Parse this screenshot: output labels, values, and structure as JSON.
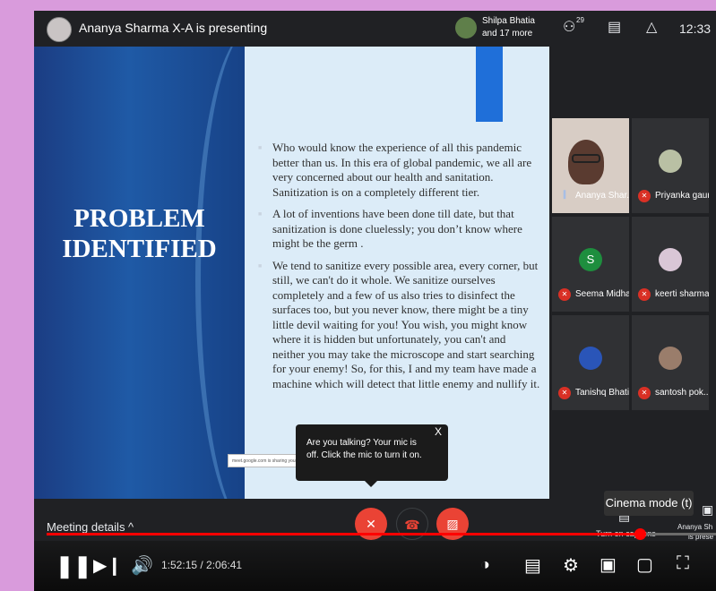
{
  "top_bar": {
    "presenter_text": "Ananya Sharma X-A is presenting",
    "participants_line1": "Shilpa Bhatia",
    "participants_line2": "and 17 more",
    "people_count": "29",
    "clock": "12:33",
    "icons": [
      "people-icon",
      "chat-icon",
      "activities-icon"
    ]
  },
  "slide": {
    "title_line1": "PROBLEM",
    "title_line2": "IDENTIFIED",
    "paragraphs": [
      "Who would know the experience of all this pandemic better than us. In this era of global pandemic, we all are very concerned about our health and sanitation. Sanitization is on a completely different tier.",
      "A lot of inventions have been done till date, but that sanitization is done cluelessly; you don’t know where might be the germ .",
      "We tend to sanitize every possible area, every corner, but still, we can't do it whole. We sanitize ourselves completely and a few of us also tries to disinfect the surfaces too, but you never know, there might be a tiny little devil waiting for you! You wish, you might know where it is hidden but unfortunately, you can't and neither you may take the microscope and start searching for your enemy! So, for this, I and my team have made a machine which will detect that little enemy and nullify it."
    ],
    "share_chip": "meet.google.com is sharing your screen"
  },
  "mic_tooltip": {
    "text": "Are you talking? Your mic is off. Click the mic to turn it on.",
    "close": "X"
  },
  "tiles": [
    {
      "name": "Ananya Shar...",
      "muted": false
    },
    {
      "name": "Priyanka gaur",
      "muted": true
    },
    {
      "name": "Seema Midha",
      "muted": true,
      "initial": "S"
    },
    {
      "name": "keerti sharma",
      "muted": true
    },
    {
      "name": "Tanishq Bhati",
      "muted": true
    },
    {
      "name": "santosh pok...",
      "muted": true
    }
  ],
  "controls": {
    "meeting_details": "Meeting details  ^",
    "captions_label": "Turn on captions",
    "present_name": "Ananya Sh",
    "present_status": "is prese",
    "cinema_tooltip": "Cinema mode (t)"
  },
  "player": {
    "time": "1:52:15 / 2:06:41",
    "progress": 0.886
  },
  "colors": {
    "page_border": "#d99bdc",
    "meet_bg": "#202124",
    "slide_bg": "#dcecf8",
    "slide_blue": "#1f5aa6",
    "danger_red": "#ea4335",
    "progress_red": "#ff0000"
  }
}
